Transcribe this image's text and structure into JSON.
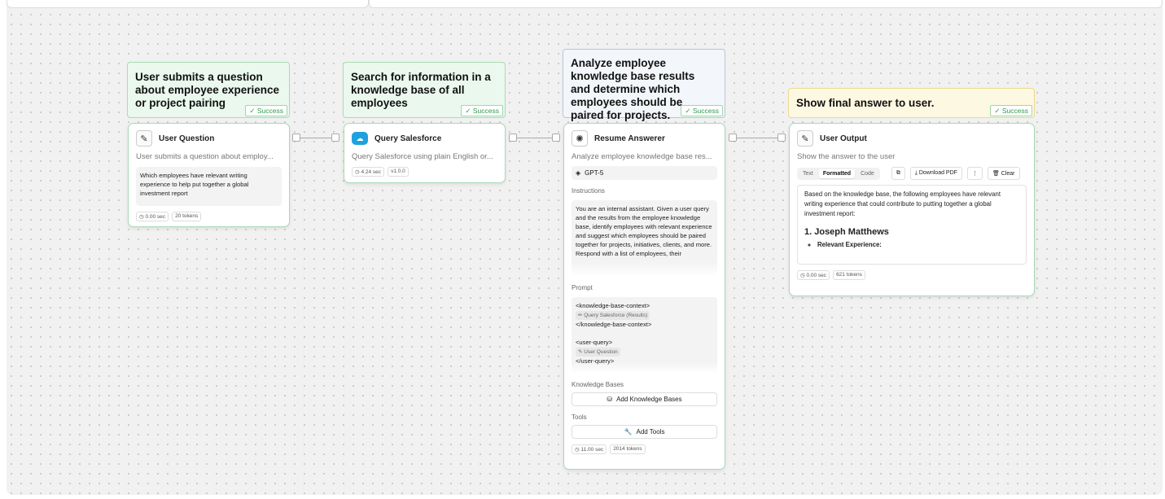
{
  "notes": {
    "n1": "User submits a question about employee experience or project pairing",
    "n2": "Search for information in a knowledge base of all employees",
    "n3": "Analyze employee knowledge base results and determine which employees should be paired for projects.",
    "n4": "Show final answer to user.",
    "success_label": "✓ Success"
  },
  "user_question": {
    "title": "User Question",
    "description": "User submits a question about employ...",
    "value": "Which employees have relevant writing experience to help put together a global investment report",
    "time": "◷ 0.00 sec",
    "tokens": "20 tokens"
  },
  "query_salesforce": {
    "title": "Query Salesforce",
    "description": "Query Salesforce using plain English or...",
    "time": "◷ 4.24 sec",
    "version": "v1.0.0"
  },
  "resume_answerer": {
    "title": "Resume Answerer",
    "description": "Analyze employee knowledge base res...",
    "model": "GPT-5",
    "instructions_label": "Instructions",
    "instructions": "You are an internal assistant. Given a user query and the results from the employee knowledge base, identify employees with relevant experience and suggest which employees should be paired together for projects, initiatives, clients, and more. Respond with a list of employees, their",
    "prompt_label": "Prompt",
    "prompt_line1": "<knowledge-base-context>",
    "prompt_chip1": "✏ Query Salesforce (Results)",
    "prompt_line2": "</knowledge-base-context>",
    "prompt_line3": "<user-query>",
    "prompt_chip2": "✎ User Question",
    "prompt_line4": "</user-query>",
    "kb_label": "Knowledge Bases",
    "kb_button": "Add Knowledge Bases",
    "tools_label": "Tools",
    "tools_button": "Add Tools",
    "time": "◷ 11.00 sec",
    "tokens": "2014 tokens"
  },
  "user_output": {
    "title": "User Output",
    "description": "Show the answer to the user",
    "tab_text": "Text",
    "tab_formatted": "Formatted",
    "tab_code": "Code",
    "download": "⤓ Download PDF",
    "more": "⋮",
    "clear": "🗑 Clear",
    "output_para": "Based on the knowledge base, the following employees have relevant writing experience that could contribute to putting together a global investment report:",
    "output_heading": "1. Joseph Matthews",
    "output_bullet": "Relevant Experience:",
    "time": "◷ 0.00 sec",
    "tokens": "621 tokens"
  }
}
